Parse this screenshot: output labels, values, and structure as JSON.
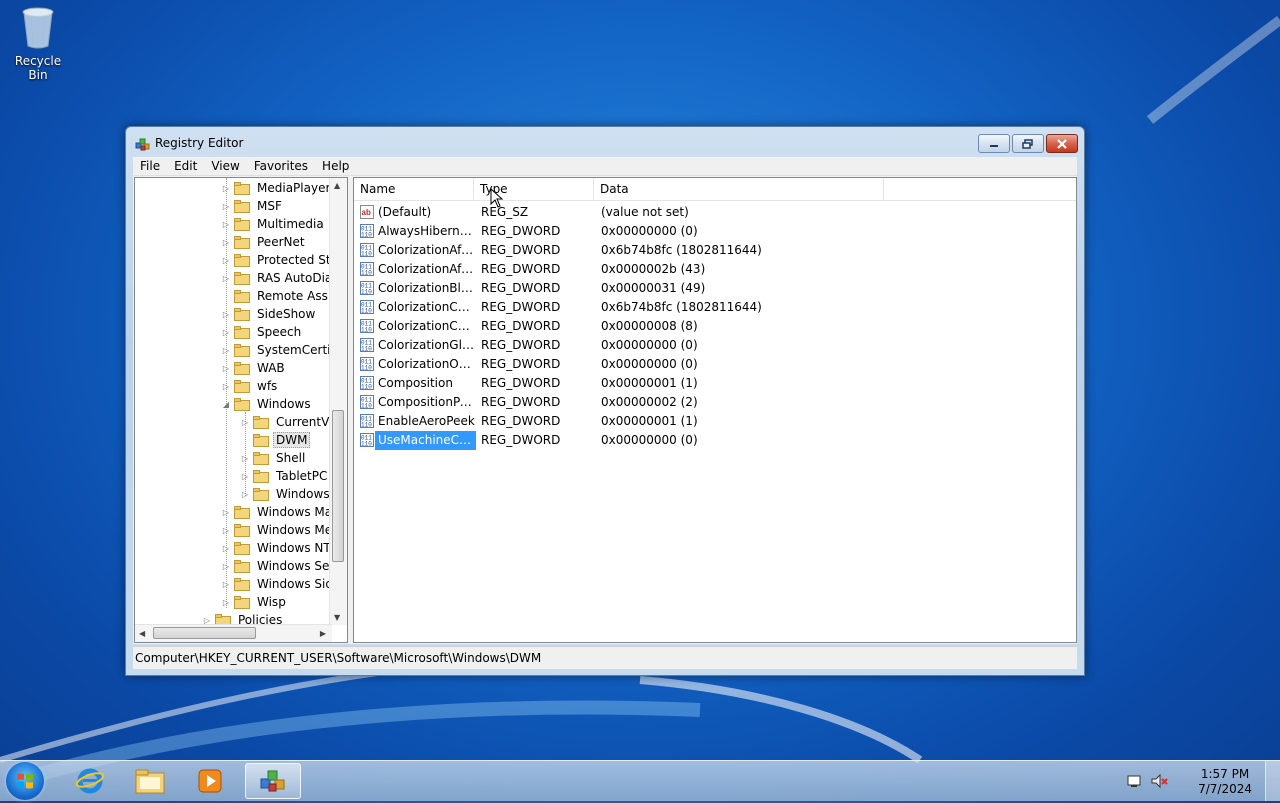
{
  "desktop": {
    "recycle_bin_label": "Recycle Bin"
  },
  "window": {
    "title": "Registry Editor",
    "menu": [
      "File",
      "Edit",
      "View",
      "Favorites",
      "Help"
    ],
    "tree": [
      {
        "label": "MediaPlayer",
        "level": 1,
        "expander": true
      },
      {
        "label": "MSF",
        "level": 1,
        "expander": true
      },
      {
        "label": "Multimedia",
        "level": 1,
        "expander": true
      },
      {
        "label": "PeerNet",
        "level": 1,
        "expander": true
      },
      {
        "label": "Protected Stor",
        "level": 1,
        "expander": true
      },
      {
        "label": "RAS AutoDial",
        "level": 1,
        "expander": true
      },
      {
        "label": "Remote Assista",
        "level": 1,
        "expander": false
      },
      {
        "label": "SideShow",
        "level": 1,
        "expander": true
      },
      {
        "label": "Speech",
        "level": 1,
        "expander": true
      },
      {
        "label": "SystemCertific",
        "level": 1,
        "expander": true
      },
      {
        "label": "WAB",
        "level": 1,
        "expander": true
      },
      {
        "label": "wfs",
        "level": 1,
        "expander": true
      },
      {
        "label": "Windows",
        "level": 1,
        "expander": "open"
      },
      {
        "label": "CurrentVer",
        "level": 2,
        "expander": true
      },
      {
        "label": "DWM",
        "level": 2,
        "expander": false,
        "selected": true
      },
      {
        "label": "Shell",
        "level": 2,
        "expander": true
      },
      {
        "label": "TabletPC",
        "level": 2,
        "expander": true
      },
      {
        "label": "Windows E",
        "level": 2,
        "expander": true
      },
      {
        "label": "Windows Mail",
        "level": 1,
        "expander": true
      },
      {
        "label": "Windows Med",
        "level": 1,
        "expander": true
      },
      {
        "label": "Windows NT",
        "level": 1,
        "expander": true
      },
      {
        "label": "Windows Sear",
        "level": 1,
        "expander": true
      },
      {
        "label": "Windows Sidel",
        "level": 1,
        "expander": true
      },
      {
        "label": "Wisp",
        "level": 1,
        "expander": true
      },
      {
        "label": "Policies",
        "level": 0,
        "expander": true
      }
    ],
    "columns": {
      "name": "Name",
      "type": "Type",
      "data": "Data"
    },
    "values": [
      {
        "name": "(Default)",
        "type": "REG_SZ",
        "data": "(value not set)",
        "icon": "string-value-icon"
      },
      {
        "name": "AlwaysHibernat...",
        "type": "REG_DWORD",
        "data": "0x00000000 (0)",
        "icon": "binary-value-icon"
      },
      {
        "name": "ColorizationAfte...",
        "type": "REG_DWORD",
        "data": "0x6b74b8fc (1802811644)",
        "icon": "binary-value-icon"
      },
      {
        "name": "ColorizationAfte...",
        "type": "REG_DWORD",
        "data": "0x0000002b (43)",
        "icon": "binary-value-icon"
      },
      {
        "name": "ColorizationBlur...",
        "type": "REG_DWORD",
        "data": "0x00000031 (49)",
        "icon": "binary-value-icon"
      },
      {
        "name": "ColorizationColor",
        "type": "REG_DWORD",
        "data": "0x6b74b8fc (1802811644)",
        "icon": "binary-value-icon"
      },
      {
        "name": "ColorizationCol...",
        "type": "REG_DWORD",
        "data": "0x00000008 (8)",
        "icon": "binary-value-icon"
      },
      {
        "name": "ColorizationGlas...",
        "type": "REG_DWORD",
        "data": "0x00000000 (0)",
        "icon": "binary-value-icon"
      },
      {
        "name": "ColorizationOpa...",
        "type": "REG_DWORD",
        "data": "0x00000000 (0)",
        "icon": "binary-value-icon"
      },
      {
        "name": "Composition",
        "type": "REG_DWORD",
        "data": "0x00000001 (1)",
        "icon": "binary-value-icon"
      },
      {
        "name": "CompositionPol...",
        "type": "REG_DWORD",
        "data": "0x00000002 (2)",
        "icon": "binary-value-icon"
      },
      {
        "name": "EnableAeroPeek",
        "type": "REG_DWORD",
        "data": "0x00000001 (1)",
        "icon": "binary-value-icon"
      },
      {
        "name": "UseMachineChe...",
        "type": "REG_DWORD",
        "data": "0x00000000 (0)",
        "icon": "binary-value-icon",
        "selected": true
      }
    ],
    "status_path": "Computer\\HKEY_CURRENT_USER\\Software\\Microsoft\\Windows\\DWM"
  },
  "taskbar": {
    "items": [
      "start-button",
      "internet-explorer",
      "windows-explorer",
      "windows-media-player",
      "registry-editor"
    ],
    "active": "registry-editor",
    "clock_time": "1:57 PM",
    "clock_date": "7/7/2024"
  },
  "colors": {
    "selection": "#3399ff",
    "desktop": "#1263c4"
  }
}
